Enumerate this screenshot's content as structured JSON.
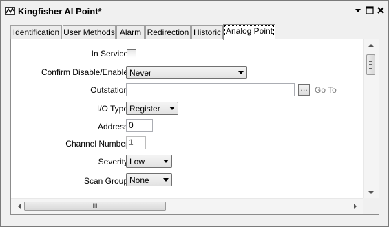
{
  "window": {
    "title": "Kingfisher AI Point*"
  },
  "tabs": [
    {
      "label": "Identification",
      "active": false
    },
    {
      "label": "User Methods",
      "active": false
    },
    {
      "label": "Alarm",
      "active": false
    },
    {
      "label": "Redirection",
      "active": false
    },
    {
      "label": "Historic",
      "active": false
    },
    {
      "label": "Analog Point",
      "active": true
    }
  ],
  "form": {
    "in_service": {
      "label": "In Service",
      "checked": false
    },
    "confirm_disable_enable": {
      "label": "Confirm Disable/Enable",
      "value": "Never"
    },
    "outstation": {
      "label": "Outstation",
      "value": "",
      "browse_label": "...",
      "goto_label": "Go To"
    },
    "io_type": {
      "label": "I/O Type",
      "value": "Register"
    },
    "address": {
      "label": "Address",
      "value": "0"
    },
    "channel_number": {
      "label": "Channel Number",
      "value": "1"
    },
    "severity": {
      "label": "Severity",
      "value": "Low"
    },
    "scan_group": {
      "label": "Scan Group",
      "value": "None"
    }
  },
  "scrollbar": {
    "h_thumb_grip": "III"
  },
  "colors": {
    "goto_link": "#7a7a7a",
    "panel_bg": "#ffffff",
    "window_bg": "#f0f0f0"
  }
}
